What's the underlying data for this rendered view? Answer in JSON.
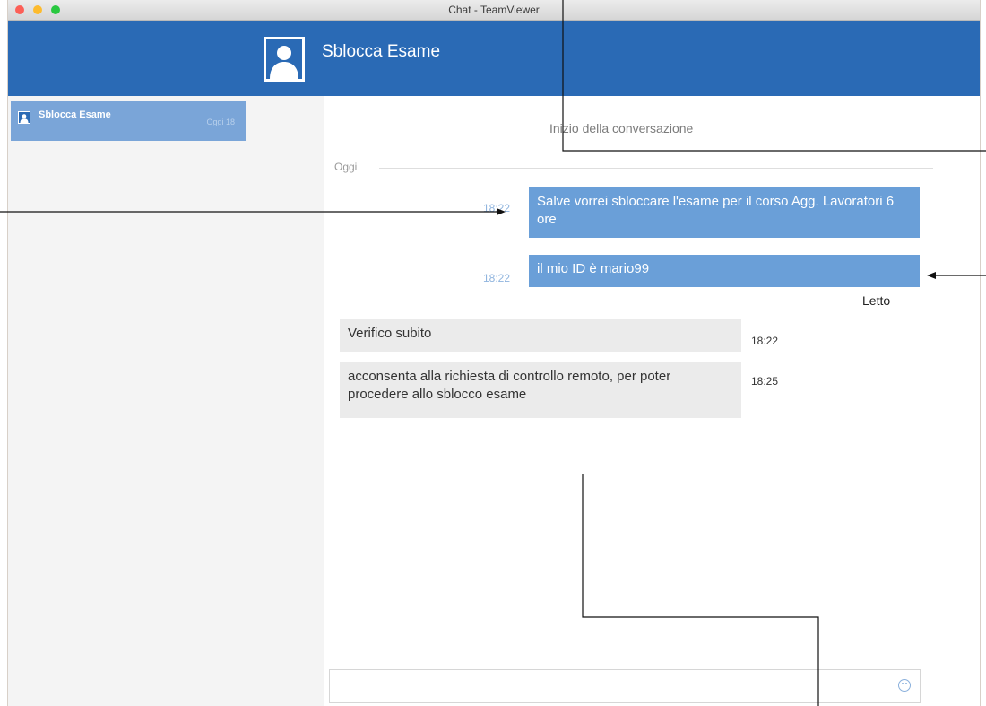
{
  "window": {
    "title": "Chat - TeamViewer"
  },
  "header": {
    "contact_name": "Sblocca Esame"
  },
  "sidebar": {
    "contacts": [
      {
        "name": "Sblocca Esame",
        "time": "Oggi 18"
      }
    ]
  },
  "conversation": {
    "start_label": "Inizio della conversazione",
    "day_label": "Oggi",
    "messages": [
      {
        "direction": "out",
        "time": "18:22",
        "text": "Salve vorrei sbloccare l'esame per il corso Agg. Lavoratori 6 ore"
      },
      {
        "direction": "out",
        "time": "18:22",
        "text": "il mio ID è mario99"
      },
      {
        "direction": "in",
        "time": "18:22",
        "text": "Verifico subito"
      },
      {
        "direction": "in",
        "time": "18:25",
        "text": "acconsenta alla richiesta di controllo remoto, per poter procedere allo sblocco esame"
      }
    ],
    "read_status": "Letto"
  },
  "composer": {
    "value": "",
    "placeholder": ""
  },
  "icons": {
    "avatar": "user-silhouette-icon",
    "emoji": "emoji-icon"
  },
  "colors": {
    "header": "#2a6ab5",
    "outgoing_bubble": "#6a9fd8",
    "incoming_bubble": "#ebebeb",
    "selected_contact": "#7aa5d8"
  }
}
